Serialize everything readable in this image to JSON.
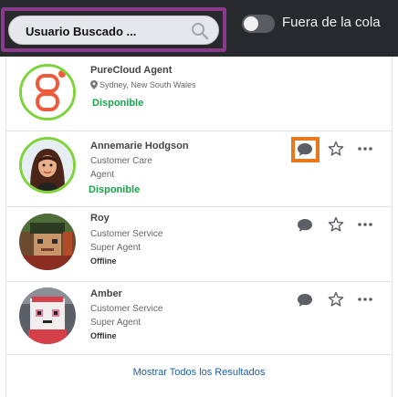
{
  "search": {
    "value": "Usuario Buscado ..."
  },
  "queue_toggle": {
    "label": "Fuera de la cola"
  },
  "results": [
    {
      "name": "PureCloud Agent",
      "location": "Sydney, New South Wales",
      "status": "Disponible"
    },
    {
      "name": "Annemarie Hodgson",
      "department": "Customer Care",
      "title": "Agent",
      "status": "Disponible"
    },
    {
      "name": "Roy",
      "department": "Customer Service",
      "title": "Super Agent",
      "status": "Offline"
    },
    {
      "name": "Amber",
      "department": "Customer Service",
      "title": "Super Agent",
      "status": "Offline"
    }
  ],
  "footer": {
    "show_all_label": "Mostrar Todos los Resultados"
  },
  "colors": {
    "highlight_purple": "#8a3a8c",
    "highlight_orange": "#e8791d",
    "available_green": "#17a34a",
    "link_blue": "#1f5fa8"
  },
  "icons": [
    "search-icon",
    "map-pin-icon",
    "chat-icon",
    "star-icon",
    "more-options-icon"
  ]
}
